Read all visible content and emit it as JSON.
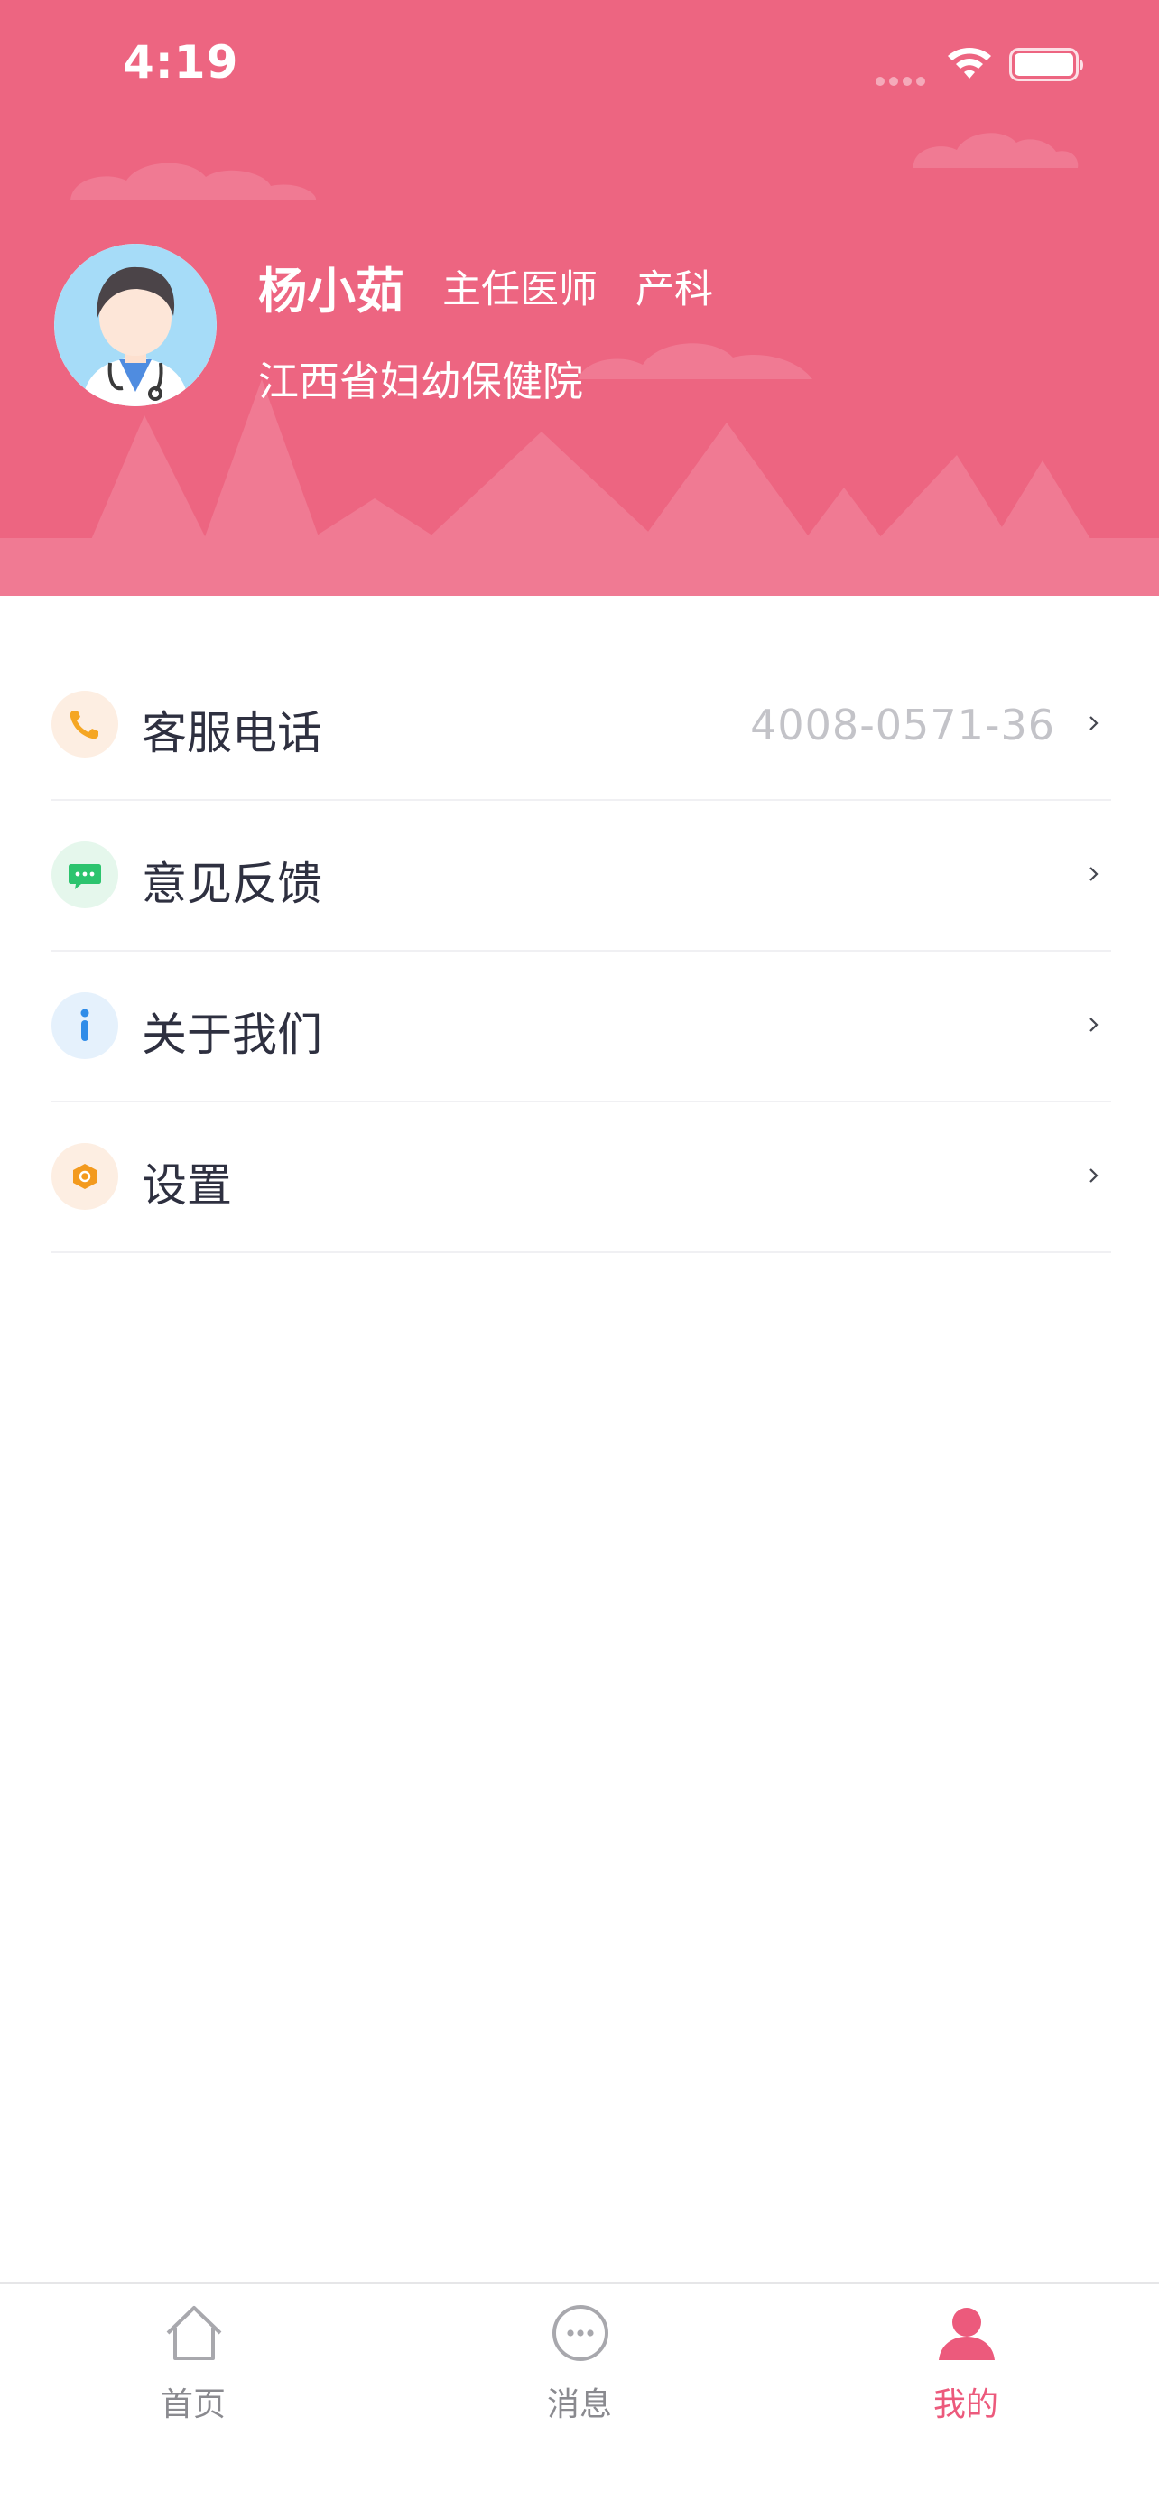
{
  "status_bar": {
    "time": "4:19",
    "icons": [
      "signal-dots-icon",
      "wifi-icon",
      "battery-icon"
    ]
  },
  "profile": {
    "name": "杨小茹",
    "title": "主任医师",
    "department": "产科",
    "hospital": "江西省妇幼保健院",
    "avatar_icon": "doctor-avatar-icon"
  },
  "menu": {
    "items": [
      {
        "label": "客服电话",
        "value": "4008-0571-36",
        "icon": "phone-icon",
        "icon_color": "#f5a623",
        "icon_bg": "#fdeee2"
      },
      {
        "label": "意见反馈",
        "value": "",
        "icon": "feedback-chat-icon",
        "icon_color": "#2cc46e",
        "icon_bg": "#e5f7ec"
      },
      {
        "label": "关于我们",
        "value": "",
        "icon": "info-icon",
        "icon_color": "#2f8ce8",
        "icon_bg": "#e5f1fc"
      },
      {
        "label": "设置",
        "value": "",
        "icon": "settings-nut-icon",
        "icon_color": "#f39a1e",
        "icon_bg": "#fdeee2"
      }
    ]
  },
  "tabbar": {
    "tabs": [
      {
        "label": "首页",
        "icon": "home-icon",
        "active": false
      },
      {
        "label": "消息",
        "icon": "message-icon",
        "active": false
      },
      {
        "label": "我的",
        "icon": "profile-icon",
        "active": true
      }
    ]
  },
  "colors": {
    "header": "#ed6581",
    "accent": "#ec5a7c",
    "text_primary": "#2e3040",
    "text_muted": "#c3c3c8",
    "tab_inactive": "#8a8a8f"
  }
}
